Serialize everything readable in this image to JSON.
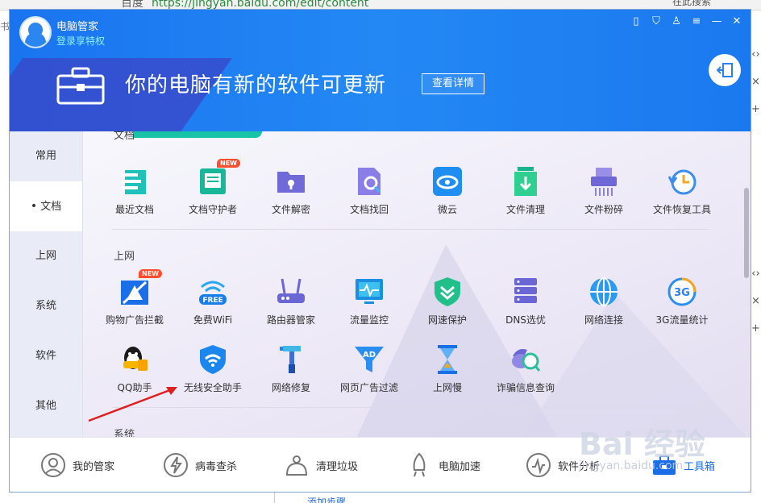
{
  "background": {
    "url_host": "百度",
    "url": "https://jingyan.baidu.com/edit/content",
    "right_text": "在此搜索",
    "bottom_link": "添加步骤",
    "left_char": "书签"
  },
  "header": {
    "app_title": "电脑管家",
    "login_text": "登录享特权",
    "banner_text": "你的电脑有新的软件可更新",
    "banner_button": "查看详情",
    "window_controls": [
      "phone-icon",
      "shield-icon",
      "shirt-icon",
      "menu-icon",
      "minimize-icon",
      "close-icon"
    ]
  },
  "sidebar": {
    "items": [
      {
        "label": "常用",
        "active": false
      },
      {
        "label": "文档",
        "active": true
      },
      {
        "label": "上网",
        "active": false
      },
      {
        "label": "系统",
        "active": false
      },
      {
        "label": "软件",
        "active": false
      },
      {
        "label": "其他",
        "active": false
      }
    ]
  },
  "sections": {
    "docs": {
      "title": "文档",
      "tiles": [
        {
          "label": "最近文档",
          "icon": "recent-docs-icon"
        },
        {
          "label": "文档守护者",
          "icon": "doc-guard-icon",
          "badge": "NEW"
        },
        {
          "label": "文件解密",
          "icon": "file-decrypt-icon"
        },
        {
          "label": "文档找回",
          "icon": "doc-recover-icon"
        },
        {
          "label": "微云",
          "icon": "weiyun-icon"
        },
        {
          "label": "文件清理",
          "icon": "file-clean-icon"
        },
        {
          "label": "文件粉碎",
          "icon": "file-shred-icon"
        },
        {
          "label": "文件恢复工具",
          "icon": "file-restore-icon"
        }
      ]
    },
    "web": {
      "title": "上网",
      "row1": [
        {
          "label": "购物广告拦截",
          "icon": "ad-block-icon",
          "badge": "NEW"
        },
        {
          "label": "免费WiFi",
          "icon": "free-wifi-icon"
        },
        {
          "label": "路由器管家",
          "icon": "router-icon"
        },
        {
          "label": "流量监控",
          "icon": "traffic-monitor-icon"
        },
        {
          "label": "网速保护",
          "icon": "speed-protect-icon"
        },
        {
          "label": "DNS选优",
          "icon": "dns-icon"
        },
        {
          "label": "网络连接",
          "icon": "network-icon"
        },
        {
          "label": "3G流量统计",
          "icon": "3g-icon"
        }
      ],
      "row2": [
        {
          "label": "QQ助手",
          "icon": "qq-icon"
        },
        {
          "label": "无线安全助手",
          "icon": "wifi-security-icon"
        },
        {
          "label": "网络修复",
          "icon": "network-repair-icon"
        },
        {
          "label": "网页广告过滤",
          "icon": "web-ad-filter-icon"
        },
        {
          "label": "上网慢",
          "icon": "slow-net-icon"
        },
        {
          "label": "诈骗信息查询",
          "icon": "fraud-query-icon"
        }
      ]
    },
    "system": {
      "title": "系统"
    }
  },
  "free_badge": "FREE",
  "ad_badge": "AD",
  "g3_badge": "3G",
  "bottom_bar": {
    "items": [
      {
        "label": "我的管家",
        "icon": "my-manager-icon"
      },
      {
        "label": "病毒查杀",
        "icon": "virus-scan-icon"
      },
      {
        "label": "清理垃圾",
        "icon": "clean-junk-icon"
      },
      {
        "label": "电脑加速",
        "icon": "speedup-icon"
      },
      {
        "label": "软件分析",
        "icon": "software-analysis-icon"
      },
      {
        "label": "工具箱",
        "icon": "toolbox-icon",
        "active": true
      }
    ]
  },
  "watermark": {
    "line1": "Bai 经验",
    "line2": "jingyan.baidu.com"
  },
  "colors": {
    "header": "#1a74f0",
    "accent": "#1a6fe8",
    "teal": "#18c3a7"
  }
}
